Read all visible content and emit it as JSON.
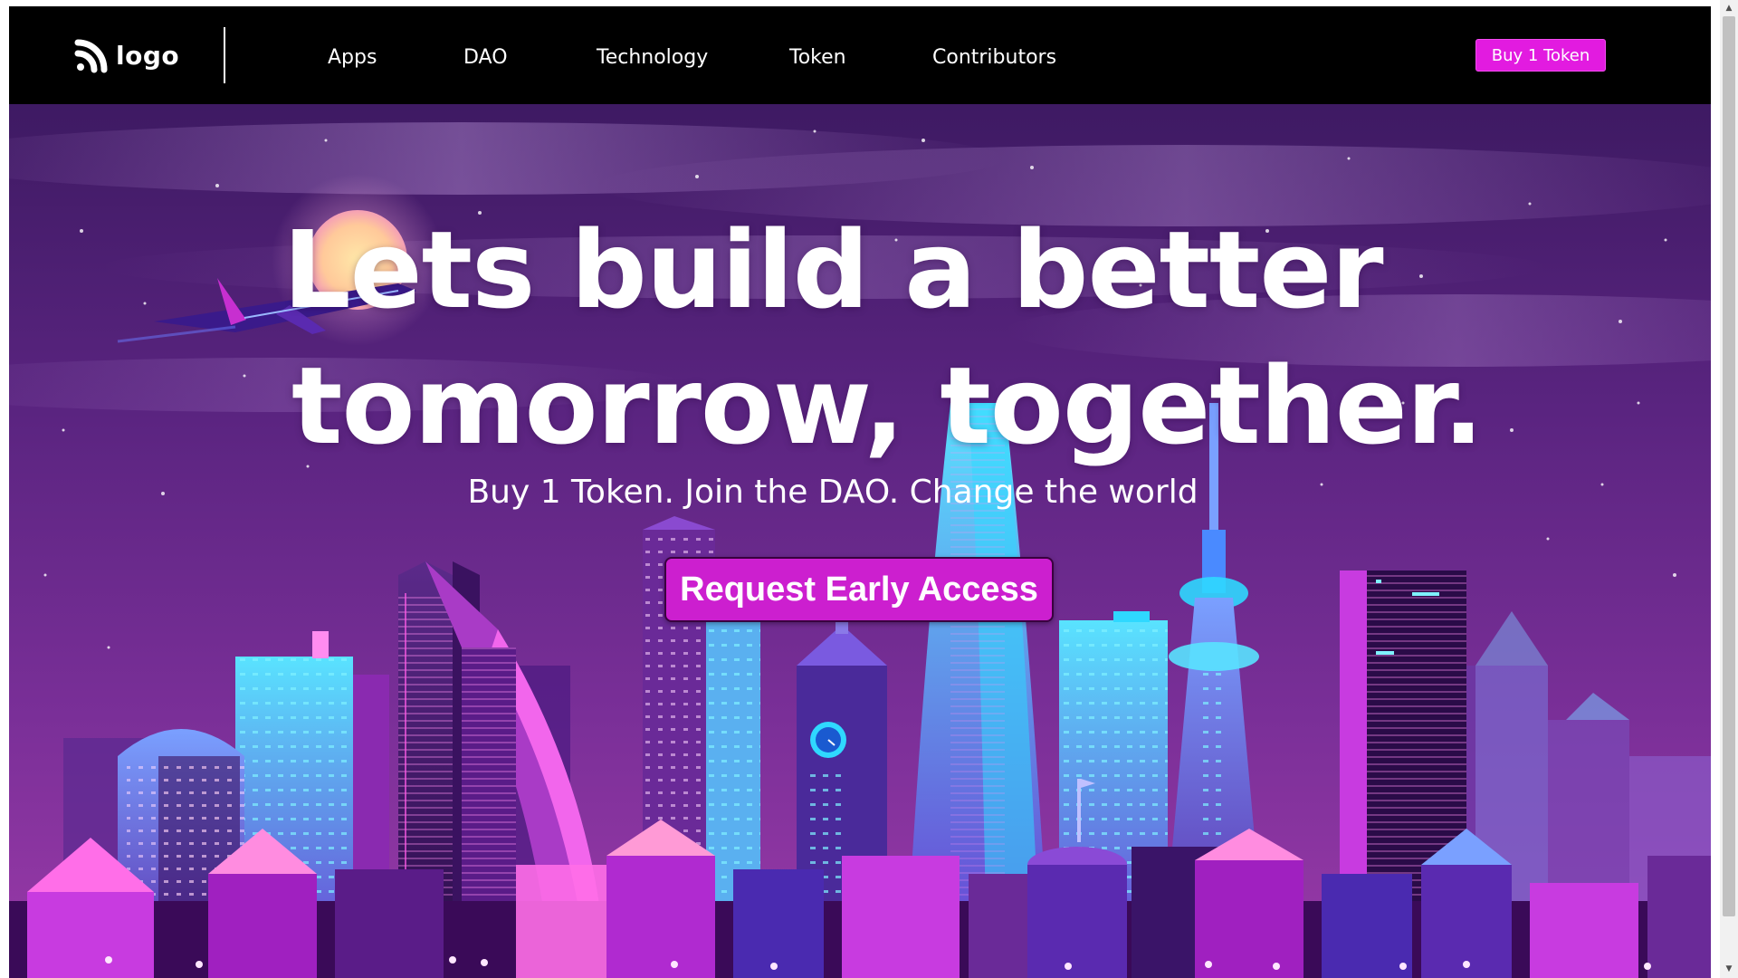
{
  "nav": {
    "logo_text": "logo",
    "links": [
      "Apps",
      "DAO",
      "Technology",
      "Token",
      "Contributors"
    ],
    "buy_button": "Buy 1 Token"
  },
  "hero": {
    "headline_line1": "Lets build a better",
    "headline_line2": "tomorrow, together.",
    "subheadline": "Buy 1 Token. Join the DAO. Change the world",
    "cta_button": "Request Early Access"
  },
  "colors": {
    "navbar_bg": "#000000",
    "accent": "#e21be0",
    "cta": "#cc1fcf",
    "sky_top": "#4a1d6e",
    "sky_bottom": "#7d2f9a"
  },
  "icons": {
    "logo": "rss-arc-logo-icon",
    "scroll_up": "scroll-up-arrow-icon",
    "scroll_down": "scroll-down-arrow-icon"
  }
}
